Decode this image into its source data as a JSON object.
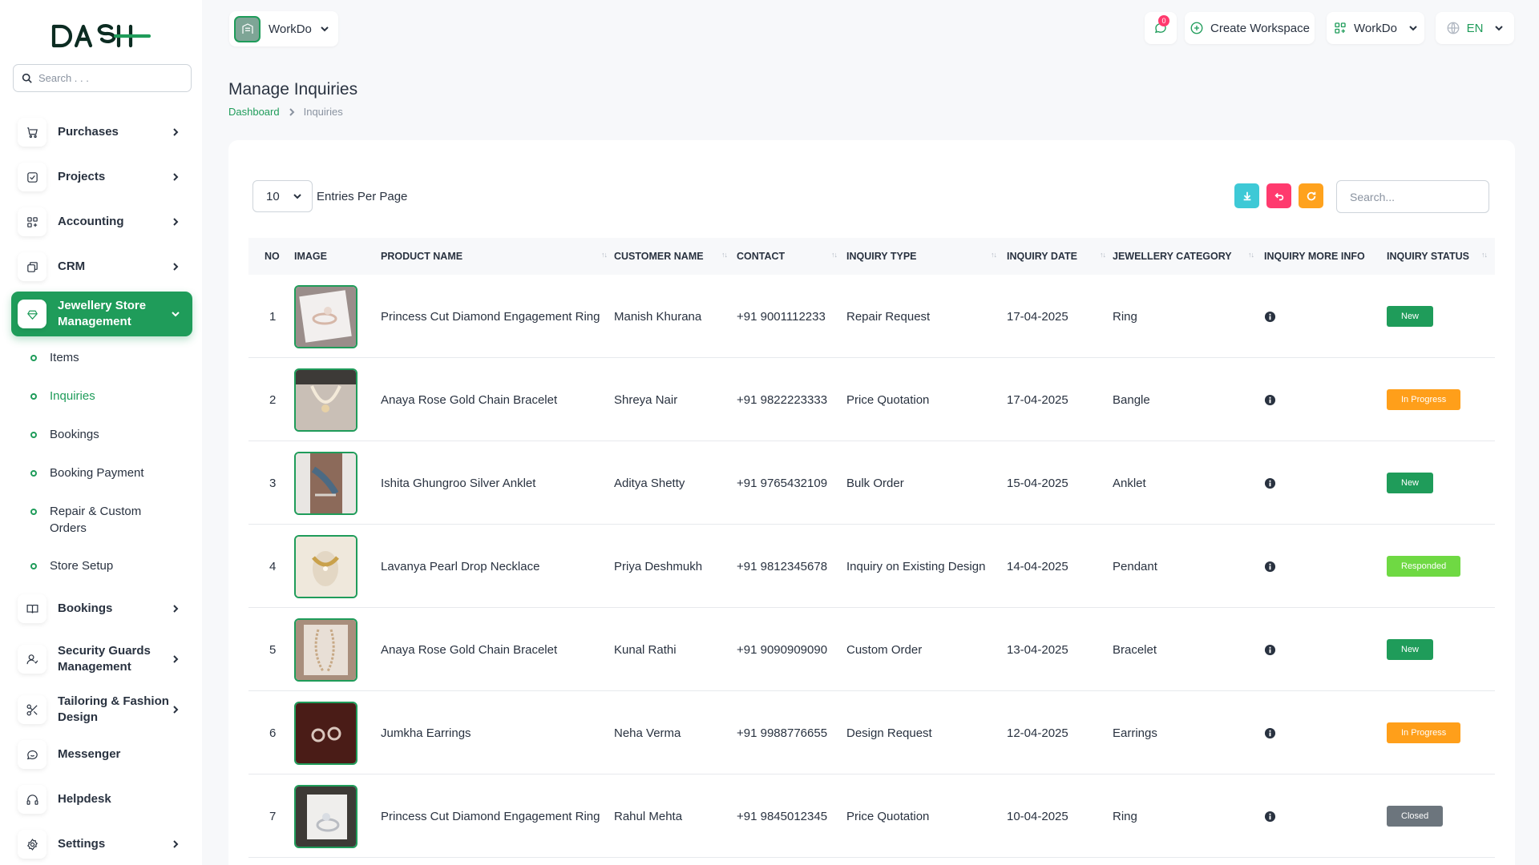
{
  "sidebar": {
    "search_placeholder": "Search . . .",
    "items": [
      {
        "label": "Purchases",
        "icon": "cart-icon"
      },
      {
        "label": "Projects",
        "icon": "project-icon"
      },
      {
        "label": "Accounting",
        "icon": "accounting-icon"
      },
      {
        "label": "CRM",
        "icon": "crm-icon"
      },
      {
        "label": "Jewellery Store Management",
        "icon": "jewel-icon"
      },
      {
        "label": "Bookings",
        "icon": "book-icon"
      },
      {
        "label": "Security Guards Management",
        "icon": "guard-icon"
      },
      {
        "label": "Tailoring & Fashion Design",
        "icon": "scissors-icon"
      },
      {
        "label": "Messenger",
        "icon": "chat-icon"
      },
      {
        "label": "Helpdesk",
        "icon": "headset-icon"
      },
      {
        "label": "Settings",
        "icon": "gear-icon"
      }
    ],
    "sub_items": [
      "Items",
      "Inquiries",
      "Bookings",
      "Booking Payment",
      "Repair & Custom Orders",
      "Store Setup"
    ]
  },
  "header": {
    "workspace_name": "WorkDo",
    "notification_count": "0",
    "create_workspace": "Create Workspace",
    "workspace_menu": "WorkDo",
    "language": "EN"
  },
  "page": {
    "title": "Manage Inquiries",
    "breadcrumb_home": "Dashboard",
    "breadcrumb_current": "Inquiries"
  },
  "table": {
    "per_page": "10",
    "per_page_label": "Entries Per Page",
    "search_placeholder": "Search...",
    "columns": [
      "No",
      "Image",
      "Product Name",
      "Customer Name",
      "Contact",
      "Inquiry Type",
      "Inquiry Date",
      "Jewellery Category",
      "Inquiry More Info",
      "Inquiry Status"
    ],
    "rows": [
      {
        "no": "1",
        "product": "Princess Cut Diamond Engagement Ring",
        "customer": "Manish Khurana",
        "contact": "+91 9001112233",
        "type": "Repair Request",
        "date": "17-04-2025",
        "category": "Ring",
        "status": "New"
      },
      {
        "no": "2",
        "product": "Anaya Rose Gold Chain Bracelet",
        "customer": "Shreya Nair",
        "contact": "+91 9822223333",
        "type": "Price Quotation",
        "date": "17-04-2025",
        "category": "Bangle",
        "status": "In Progress"
      },
      {
        "no": "3",
        "product": "Ishita Ghungroo Silver Anklet",
        "customer": "Aditya Shetty",
        "contact": "+91 9765432109",
        "type": "Bulk Order",
        "date": "15-04-2025",
        "category": "Anklet",
        "status": "New"
      },
      {
        "no": "4",
        "product": "Lavanya Pearl Drop Necklace",
        "customer": "Priya Deshmukh",
        "contact": "+91 9812345678",
        "type": "Inquiry on Existing Design",
        "date": "14-04-2025",
        "category": "Pendant",
        "status": "Responded"
      },
      {
        "no": "5",
        "product": "Anaya Rose Gold Chain Bracelet",
        "customer": "Kunal Rathi",
        "contact": "+91 9090909090",
        "type": "Custom Order",
        "date": "13-04-2025",
        "category": "Bracelet",
        "status": "New"
      },
      {
        "no": "6",
        "product": "Jumkha Earrings",
        "customer": "Neha Verma",
        "contact": "+91 9988776655",
        "type": "Design Request",
        "date": "12-04-2025",
        "category": "Earrings",
        "status": "In Progress"
      },
      {
        "no": "7",
        "product": "Princess Cut Diamond Engagement Ring",
        "customer": "Rahul Mehta",
        "contact": "+91 9845012345",
        "type": "Price Quotation",
        "date": "10-04-2025",
        "category": "Ring",
        "status": "Closed"
      }
    ]
  },
  "colors": {
    "accent": "#1f9c5a",
    "status_new": "#1f9c5a",
    "status_in_progress": "#ff9f1a",
    "status_responded": "#6fd943",
    "status_closed": "#6c757d",
    "download_btn": "#3ec9d6",
    "reset_btn": "#ff3a6e",
    "refresh_btn": "#ffa21d"
  }
}
